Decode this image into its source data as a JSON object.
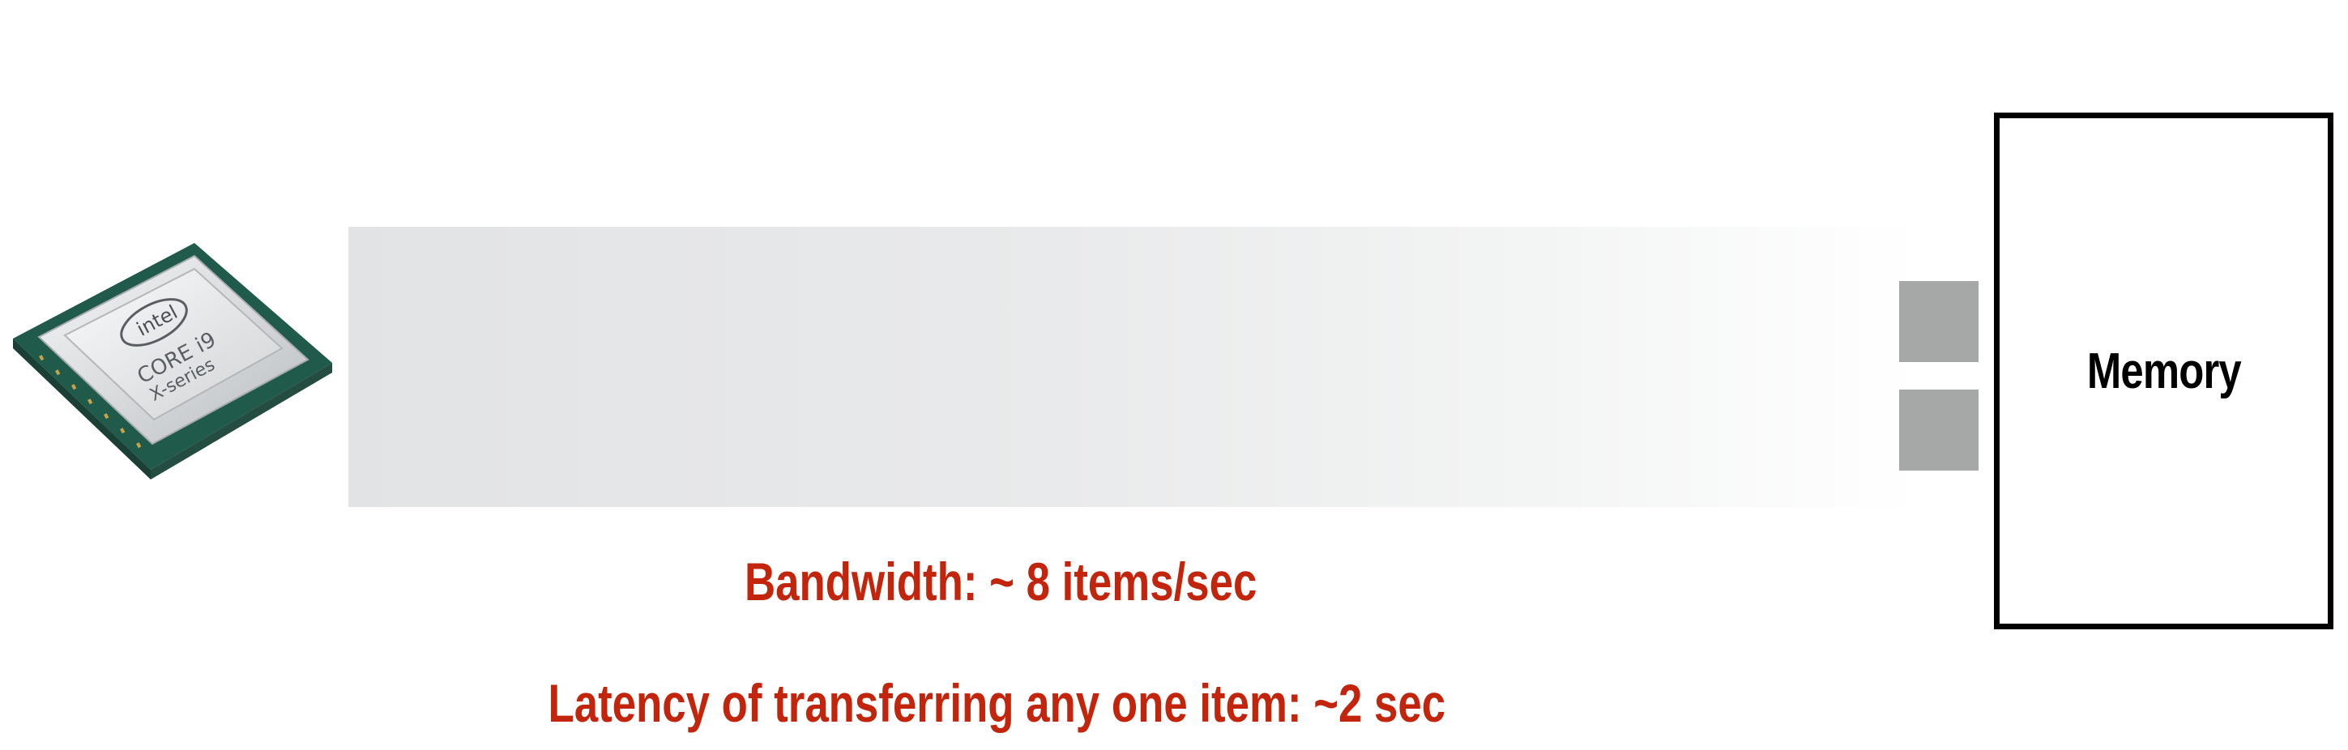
{
  "cpu": {
    "icon": "intel-core-i9-chip-icon",
    "logo_text": "intel",
    "line1": "CORE i9",
    "line2": "X-series"
  },
  "pipe": {
    "items_visible": 2
  },
  "memory": {
    "label": "Memory"
  },
  "captions": {
    "bandwidth": "Bandwidth: ~ 8 items/sec",
    "latency": "Latency of transferring any one item: ~2 sec"
  },
  "colors": {
    "caption": "#c2240c",
    "item": "#a6a8a7",
    "border": "#000000"
  }
}
